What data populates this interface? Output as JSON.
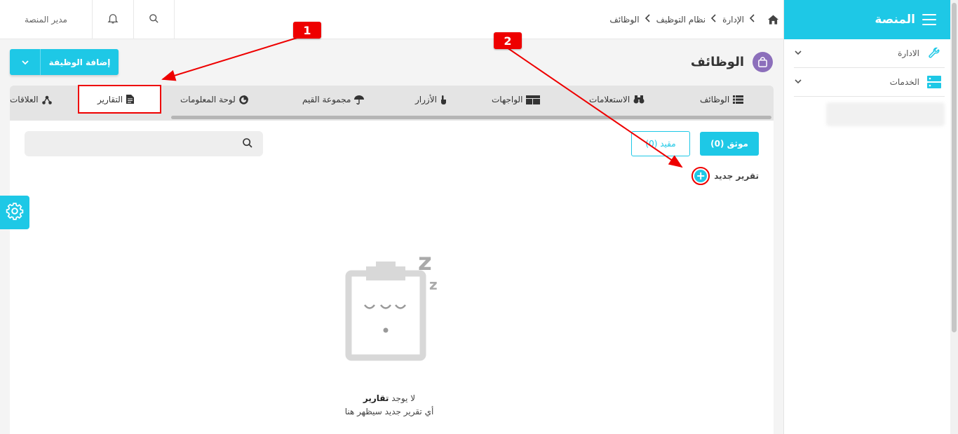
{
  "sidebar": {
    "title": "المنصة",
    "items": [
      {
        "label": "الادارة",
        "icon": "wrench-icon"
      },
      {
        "label": "الخدمات",
        "icon": "server-icon"
      }
    ]
  },
  "topbar": {
    "user": "مدير المنصة",
    "breadcrumb": [
      "الإدارة",
      "نظام التوظيف",
      "الوظائف"
    ]
  },
  "page": {
    "title": "الوظائف",
    "add_button": "إضافة الوظيفة"
  },
  "tabs": [
    {
      "label": "الوظائف",
      "icon": "list-icon"
    },
    {
      "label": "الاستعلامات",
      "icon": "binoculars-icon"
    },
    {
      "label": "الواجهات",
      "icon": "layout-icon"
    },
    {
      "label": "الأزرار",
      "icon": "pointer-icon"
    },
    {
      "label": "مجموعة القيم",
      "icon": "umbrella-icon"
    },
    {
      "label": "لوحة المعلومات",
      "icon": "pie-chart-icon"
    },
    {
      "label": "التقارير",
      "icon": "file-icon"
    },
    {
      "label": "العلاقات",
      "icon": "share-nodes-icon"
    }
  ],
  "filters": {
    "verified": "موثق (0)",
    "restricted": "مقيد (0)"
  },
  "search": {
    "placeholder": ""
  },
  "new_report": "تقرير جديد",
  "empty": {
    "line1_prefix": "لا يوجد",
    "line1_bold": "تقارير",
    "line2": "أي تقرير جديد سيظهر هنا"
  },
  "annotations": [
    "1",
    "2"
  ],
  "colors": {
    "accent": "#1ec8e6",
    "highlight": "#e00000",
    "title_icon": "#8c6fbb"
  }
}
